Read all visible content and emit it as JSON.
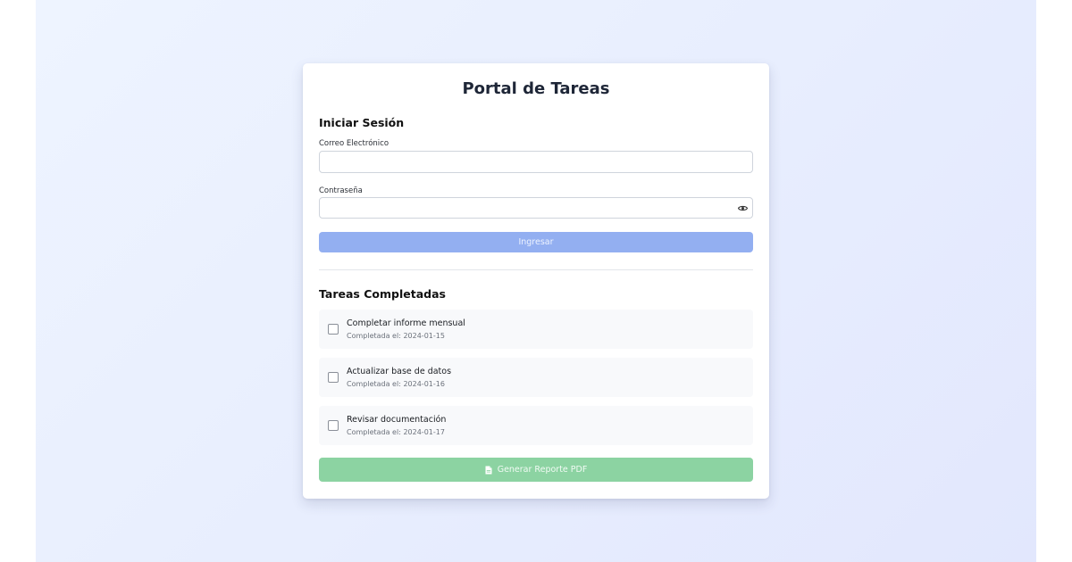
{
  "app": {
    "title": "Portal de Tareas"
  },
  "login": {
    "title": "Iniciar Sesión",
    "email_label": "Correo Electrónico",
    "email_value": "",
    "email_placeholder": "",
    "password_label": "Contraseña",
    "password_value": "",
    "password_placeholder": "",
    "submit_label": "Ingresar",
    "icons": {
      "password_toggle": "eye-icon"
    }
  },
  "tasks": {
    "title": "Tareas Completadas",
    "items": [
      {
        "name": "Completar informe mensual",
        "date": "Completada el: 2024-01-15"
      },
      {
        "name": "Actualizar base de datos",
        "date": "Completada el: 2024-01-16"
      },
      {
        "name": "Revisar documentación",
        "date": "Completada el: 2024-01-17"
      }
    ],
    "report_label": "Generar Reporte PDF",
    "report_icon": "file-pdf-icon"
  },
  "colors": {
    "primary_button": "#93aff1",
    "report_button": "#8cd3a2",
    "title_text": "#1e2637"
  }
}
